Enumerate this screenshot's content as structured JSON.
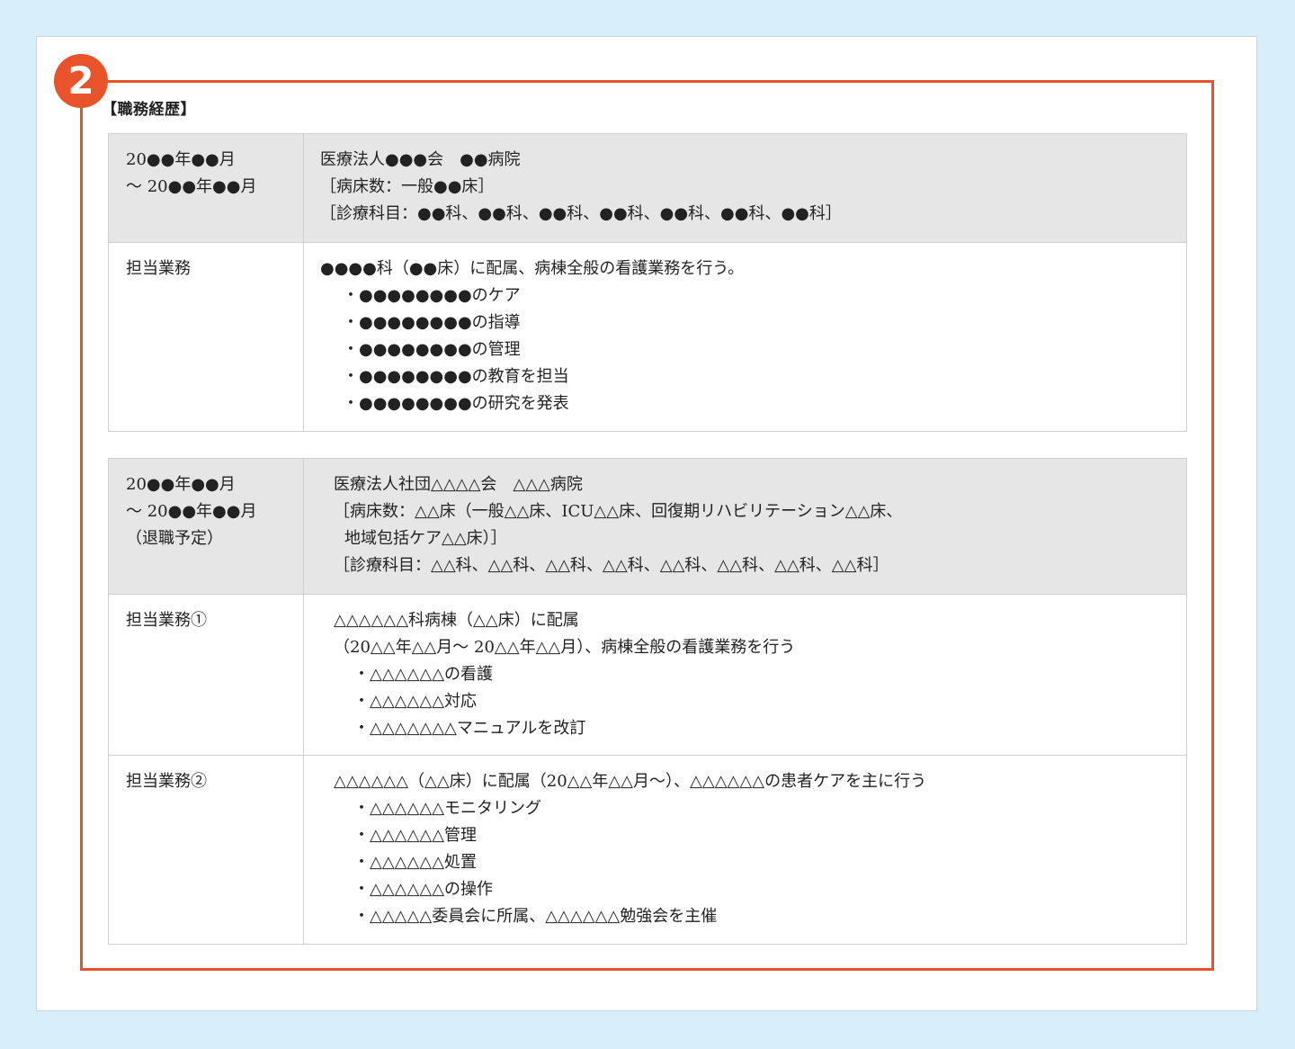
{
  "badge": "2",
  "section_title": "【職務経歴】",
  "entries": [
    {
      "period": [
        "20●●年●●月",
        "～ 20●●年●●月"
      ],
      "org": [
        "医療法人●●●会　●●病院",
        "［病床数：一般●●床］",
        "［診療科目：●●科、●●科、●●科、●●科、●●科、●●科、●●科］"
      ],
      "duties": [
        {
          "label": "担当業務",
          "lines": [
            "●●●●科（●●床）に配属、病棟全般の看護業務を行う。"
          ],
          "bullets": [
            "・●●●●●●●●のケア",
            "・●●●●●●●●の指導",
            "・●●●●●●●●の管理",
            "・●●●●●●●●の教育を担当",
            "・●●●●●●●●の研究を発表"
          ]
        }
      ]
    },
    {
      "period": [
        "20●●年●●月",
        "～ 20●●年●●月",
        "（退職予定）"
      ],
      "org": [
        "医療法人社団△△△△会　△△△病院",
        "［病床数：△△床（一般△△床、ICU△△床、回復期リハビリテーション△△床、",
        "地域包括ケア△△床）］",
        "［診療科目：△△科、△△科、△△科、△△科、△△科、△△科、△△科、△△科］"
      ],
      "duties": [
        {
          "label": "担当業務①",
          "lines": [
            "△△△△△△科病棟（△△床）に配属",
            "（20△△年△△月～ 20△△年△△月）、病棟全般の看護業務を行う"
          ],
          "bullets": [
            "・△△△△△△の看護",
            "・△△△△△△対応",
            "・△△△△△△△マニュアルを改訂"
          ]
        },
        {
          "label": "担当業務②",
          "lines": [
            "△△△△△△（△△床）に配属（20△△年△△月～）、△△△△△△の患者ケアを主に行う"
          ],
          "bullets": [
            "・△△△△△△モニタリング",
            "・△△△△△△管理",
            "・△△△△△△処置",
            "・△△△△△△の操作",
            "・△△△△△委員会に所属、△△△△△△勉強会を主催"
          ]
        }
      ]
    }
  ],
  "colors": {
    "accent": "#e9532b",
    "background": "#d9eefb",
    "header_row": "#e6e6e6",
    "border": "#cfcfcf"
  }
}
